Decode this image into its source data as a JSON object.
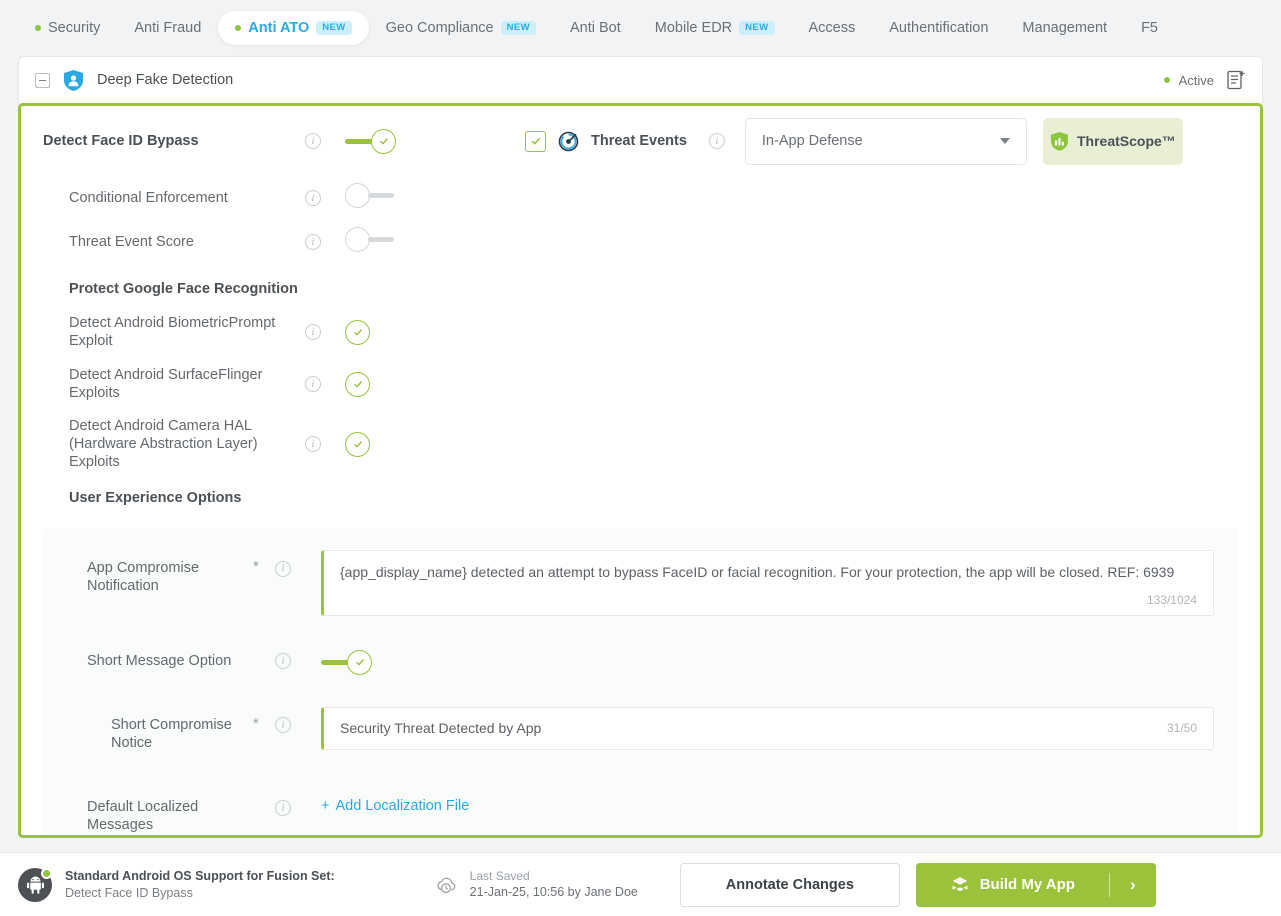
{
  "topnav": {
    "items": [
      {
        "label": "Security",
        "dot": true,
        "badge": "",
        "active": false
      },
      {
        "label": "Anti Fraud",
        "dot": false,
        "badge": "",
        "active": false
      },
      {
        "label": "Anti ATO",
        "dot": true,
        "badge": "NEW",
        "active": true
      },
      {
        "label": "Geo Compliance",
        "dot": false,
        "badge": "NEW",
        "active": false
      },
      {
        "label": "Anti Bot",
        "dot": false,
        "badge": "",
        "active": false
      },
      {
        "label": "Mobile EDR",
        "dot": false,
        "badge": "NEW",
        "active": false
      },
      {
        "label": "Access",
        "dot": false,
        "badge": "",
        "active": false
      },
      {
        "label": "Authentification",
        "dot": false,
        "badge": "",
        "active": false
      },
      {
        "label": "Management",
        "dot": false,
        "badge": "",
        "active": false
      },
      {
        "label": "F5",
        "dot": false,
        "badge": "",
        "active": false
      }
    ]
  },
  "card": {
    "title": "Deep Fake Detection",
    "status_label": "Active",
    "status_color": "#8cc63f"
  },
  "main": {
    "primary_row": {
      "label": "Detect Face ID Bypass",
      "toggle_state": "on",
      "threat_events_label": "Threat Events",
      "threat_events_checked": true,
      "select_value": "In-App Defense",
      "threatscope_label": "ThreatScope™"
    },
    "rows": [
      {
        "label": "Conditional Enforcement",
        "control": "toggle",
        "state": "off",
        "indent": 1
      },
      {
        "label": "Threat Event Score",
        "control": "toggle",
        "state": "off",
        "indent": 1
      }
    ],
    "section_google": {
      "title": "Protect Google Face Recognition",
      "rows": [
        {
          "label": "Detect Android BiometricPrompt Exploit",
          "control": "check"
        },
        {
          "label": "Detect Android SurfaceFlinger Exploits",
          "control": "check"
        },
        {
          "label": "Detect Android Camera HAL (Hardware Abstraction Layer) Exploits",
          "control": "check"
        }
      ]
    },
    "section_ux": {
      "title": "User Experience Options",
      "app_compromise": {
        "label": "App Compromise Notification",
        "required": "*",
        "value": "{app_display_name} detected an attempt to bypass FaceID or facial recognition. For your protection, the app will be closed. REF: 6939",
        "counter": "133/1024"
      },
      "short_message_option": {
        "label": "Short Message Option",
        "state": "on"
      },
      "short_compromise_notice": {
        "label": "Short Compromise Notice",
        "required": "*",
        "value": "Security Threat Detected by App",
        "counter": "31/50"
      },
      "default_localized": {
        "label": "Default Localized Messages",
        "link_plus": "+",
        "link_label": "Add Localization File"
      }
    }
  },
  "footer": {
    "fusion_title": "Standard Android OS Support for Fusion Set:",
    "fusion_sub": "Detect Face ID Bypass",
    "saved_title": "Last Saved",
    "saved_value": "21-Jan-25, 10:56 by Jane Doe",
    "annotate_label": "Annotate Changes",
    "build_label": "Build My App",
    "build_chevron": "›"
  },
  "colors": {
    "accent_green": "#9ac23a",
    "accent_blue": "#29abe2",
    "badge_bg": "#cdeffc"
  }
}
